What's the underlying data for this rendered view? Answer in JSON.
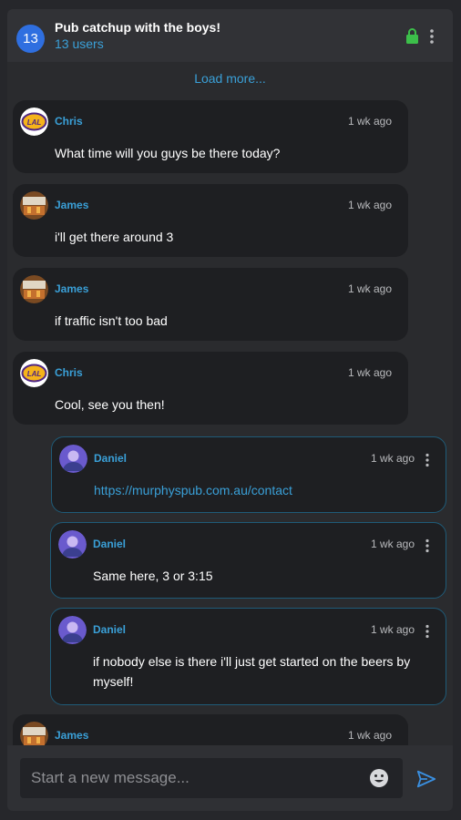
{
  "header": {
    "count_badge": "13",
    "title": "Pub catchup with the boys!",
    "subtitle": "13 users"
  },
  "load_more": "Load more...",
  "messages": [
    {
      "author": "Chris",
      "time": "1 wk ago",
      "text": "What time will you guys be there today?",
      "avatar": "lakers-logo"
    },
    {
      "author": "James",
      "time": "1 wk ago",
      "text": "i'll get there around 3",
      "avatar": "pub-photo"
    },
    {
      "author": "James",
      "time": "1 wk ago",
      "text": "if traffic isn't too bad",
      "avatar": "pub-photo"
    },
    {
      "author": "Chris",
      "time": "1 wk ago",
      "text": "Cool, see you then!",
      "avatar": "lakers-logo"
    },
    {
      "author": "Daniel",
      "time": "1 wk ago",
      "text": "https://murphyspub.com.au/contact",
      "avatar": "daniel-photo",
      "is_link": true
    },
    {
      "author": "Daniel",
      "time": "1 wk ago",
      "text": "Same here, 3 or 3:15",
      "avatar": "daniel-photo"
    },
    {
      "author": "Daniel",
      "time": "1 wk ago",
      "text_line1": "if nobody else is there i'll just get started on the beers by",
      "text_line2": "myself!",
      "avatar": "daniel-photo"
    },
    {
      "author": "James",
      "time": "1 wk ago",
      "avatar": "pub-photo"
    }
  ],
  "composer": {
    "placeholder": "Start a new message..."
  },
  "colors": {
    "accent": "#3aa0d8",
    "badge": "#2f6fe0",
    "lock": "#3cbf4a",
    "own_message_border": "#1f5b78"
  },
  "icons": {
    "lock": "lock-icon",
    "menu": "more-vert-icon",
    "emoji": "emoji-icon",
    "send": "send-icon"
  }
}
